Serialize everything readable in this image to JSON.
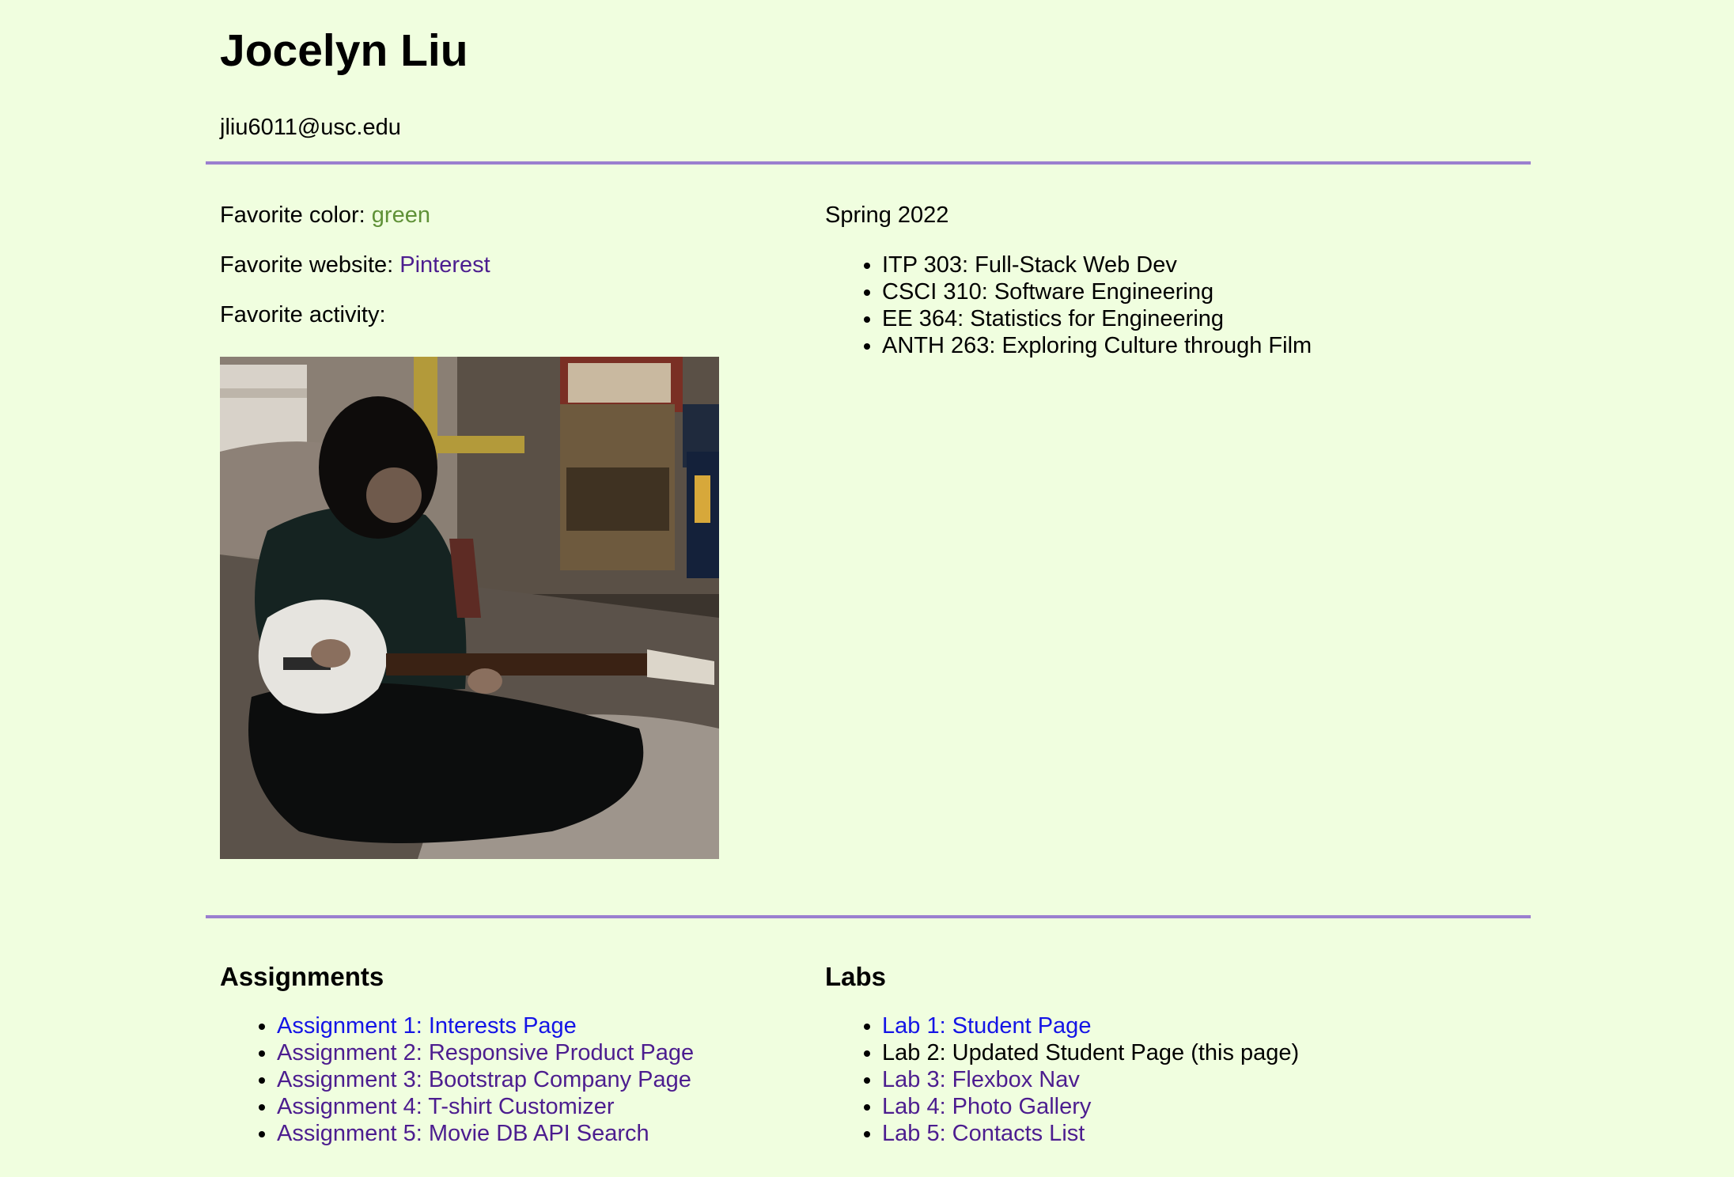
{
  "header": {
    "name": "Jocelyn Liu",
    "email": "jliu6011@usc.edu"
  },
  "favorites": {
    "color_label": "Favorite color:",
    "color_value": "green",
    "website_label": "Favorite website:",
    "website_value": "Pinterest",
    "activity_label": "Favorite activity:"
  },
  "courses": {
    "term": "Spring 2022",
    "items": [
      "ITP 303: Full-Stack Web Dev",
      "CSCI 310: Software Engineering",
      "EE 364: Statistics for Engineering",
      "ANTH 263: Exploring Culture through Film"
    ]
  },
  "assignments": {
    "title": "Assignments",
    "items": [
      "Assignment 1: Interests Page",
      "Assignment 2: Responsive Product Page",
      "Assignment 3: Bootstrap Company Page",
      "Assignment 4: T-shirt Customizer",
      "Assignment 5: Movie DB API Search"
    ]
  },
  "labs": {
    "title": "Labs",
    "items": [
      "Lab 1: Student Page",
      "Lab 2: Updated Student Page (this page)",
      "Lab 3: Flexbox Nav",
      "Lab 4: Photo Gallery",
      "Lab 5: Contacts List"
    ]
  },
  "colors": {
    "background": "#f0fedf",
    "divider": "#9b7fcf",
    "link": "#1414e6",
    "visited_link": "#4c1d8f",
    "green_text": "#5f9137"
  }
}
